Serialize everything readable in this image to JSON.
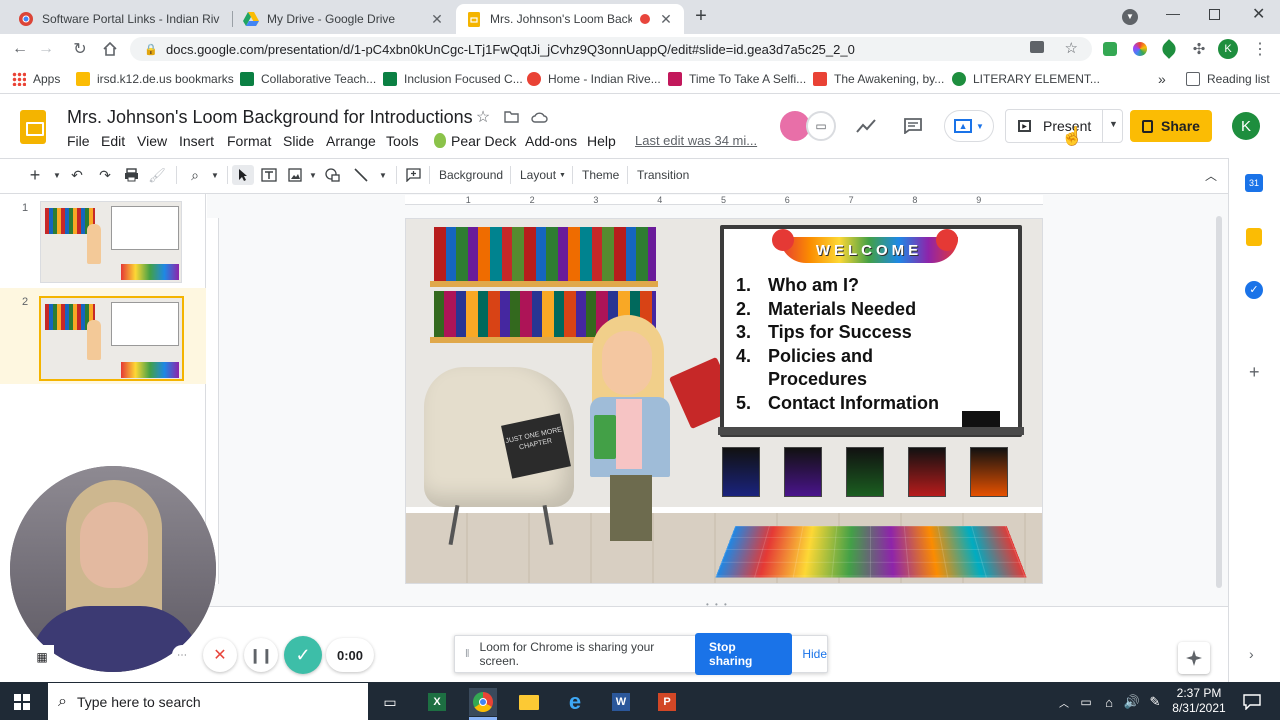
{
  "browser": {
    "tabs": [
      {
        "title": "Software Portal Links - Indian Riv",
        "favicon_color": "#e94235"
      },
      {
        "title": "My Drive - Google Drive",
        "favicon_color": "#1fa463"
      },
      {
        "title": "Mrs. Johnson's Loom Backgr",
        "favicon_color": "#f4b400"
      }
    ],
    "new_tab_label": "+",
    "url": "docs.google.com/presentation/d/1-pC4xbn0kUnCgc-LTj1FwQqtJi_jCvhz9Q3onnUappQ/edit#slide=id.gea3d7a5c25_2_0",
    "bookmarks": [
      {
        "label": "Apps",
        "color": "#4285f4"
      },
      {
        "label": "irsd.k12.de.us bookmarks",
        "color": "#fbbc04"
      },
      {
        "label": "Collaborative Teach...",
        "color": "#0b8043"
      },
      {
        "label": "Inclusion Focused C...",
        "color": "#0b8043"
      },
      {
        "label": "Home - Indian Rive...",
        "color": "#e94235"
      },
      {
        "label": "Time To Take A Selfi...",
        "color": "#c2185b"
      },
      {
        "label": "The Awakening, by...",
        "color": "#e94235"
      },
      {
        "label": "LITERARY ELEMENT...",
        "color": "#1e8e3e"
      }
    ],
    "more_bookmarks": "»",
    "reading_list": "Reading list"
  },
  "slides": {
    "title": "Mrs. Johnson's Loom Background for Introductions",
    "menu": [
      "File",
      "Edit",
      "View",
      "Insert",
      "Format",
      "Slide",
      "Arrange",
      "Tools",
      "Pear Deck",
      "Add-ons",
      "Help"
    ],
    "last_edit": "Last edit was 34 mi...",
    "present_label": "Present",
    "share_label": "Share",
    "avatar_letter": "K",
    "toolbar": {
      "background": "Background",
      "layout": "Layout",
      "theme": "Theme",
      "transition": "Transition"
    },
    "slide_numbers": [
      "1",
      "2"
    ],
    "ruler_ticks": [
      "1",
      "2",
      "3",
      "4",
      "5",
      "6",
      "7",
      "8",
      "9"
    ]
  },
  "slide_content": {
    "banner": "WELCOME",
    "items": [
      {
        "num": "1.",
        "text": "Who am I?"
      },
      {
        "num": "2.",
        "text": "Materials Needed"
      },
      {
        "num": "3.",
        "text": "Tips for Success"
      },
      {
        "num": "4.",
        "text": "Policies and"
      },
      {
        "num": "",
        "text": "Procedures"
      },
      {
        "num": "5.",
        "text": "Contact Information"
      }
    ],
    "pillow_text": "JUST ONE MORE CHAPTER"
  },
  "loom": {
    "timer": "0:00",
    "sharing_message": "Loom for Chrome is sharing your screen.",
    "stop_label": "Stop sharing",
    "hide_label": "Hide"
  },
  "taskbar": {
    "search_placeholder": "Type here to search",
    "time": "2:37 PM",
    "date": "8/31/2021"
  },
  "colors": {
    "slides_yellow": "#f4b400",
    "share_yellow": "#fbbc04",
    "loom_blue": "#1a73e8",
    "loom_green": "#3dbea8"
  }
}
